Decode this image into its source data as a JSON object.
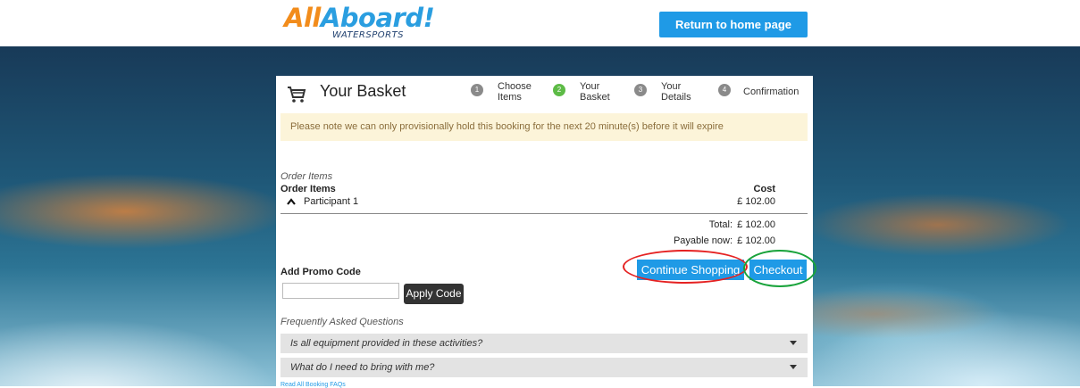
{
  "header": {
    "logo_main_prefix": "All",
    "logo_main_suffix": "Aboard!",
    "logo_sub": "WATERSPORTS",
    "home_button": "Return to home page"
  },
  "basket": {
    "title": "Your Basket",
    "steps": [
      {
        "number": "1",
        "line1": "Choose",
        "line2": "Items",
        "active": false
      },
      {
        "number": "2",
        "line1": "Your",
        "line2": "Basket",
        "active": true
      },
      {
        "number": "3",
        "line1": "Your",
        "line2": "Details",
        "active": false
      },
      {
        "number": "4",
        "line1": "Confirmation",
        "line2": "",
        "active": false
      }
    ],
    "notice": "Please note we can only provisionally hold this booking for the next 20 minute(s) before it will expire"
  },
  "order": {
    "section_label": "Order Items",
    "header_label": "Order Items",
    "cost_header": "Cost",
    "items": [
      {
        "name": "Participant 1",
        "cost": "£ 102.00"
      }
    ],
    "total_label": "Total:",
    "total_value": "£ 102.00",
    "payable_label": "Payable now:",
    "payable_value": "£ 102.00"
  },
  "promo": {
    "label": "Add Promo Code",
    "input_value": "",
    "apply_button": "Apply Code"
  },
  "actions": {
    "continue_button": "Continue Shopping",
    "checkout_button": "Checkout"
  },
  "faq": {
    "title": "Frequently Asked Questions",
    "questions": [
      "Is all equipment provided in these activities?",
      "What do I need to bring with me?"
    ],
    "read_all_link": "Read All Booking FAQs"
  },
  "colors": {
    "accent": "#1f9ae6",
    "logo_orange": "#f28c1b",
    "notice_bg": "#fcf4d9",
    "annotation_red": "#e52222",
    "annotation_green": "#19a33b"
  }
}
